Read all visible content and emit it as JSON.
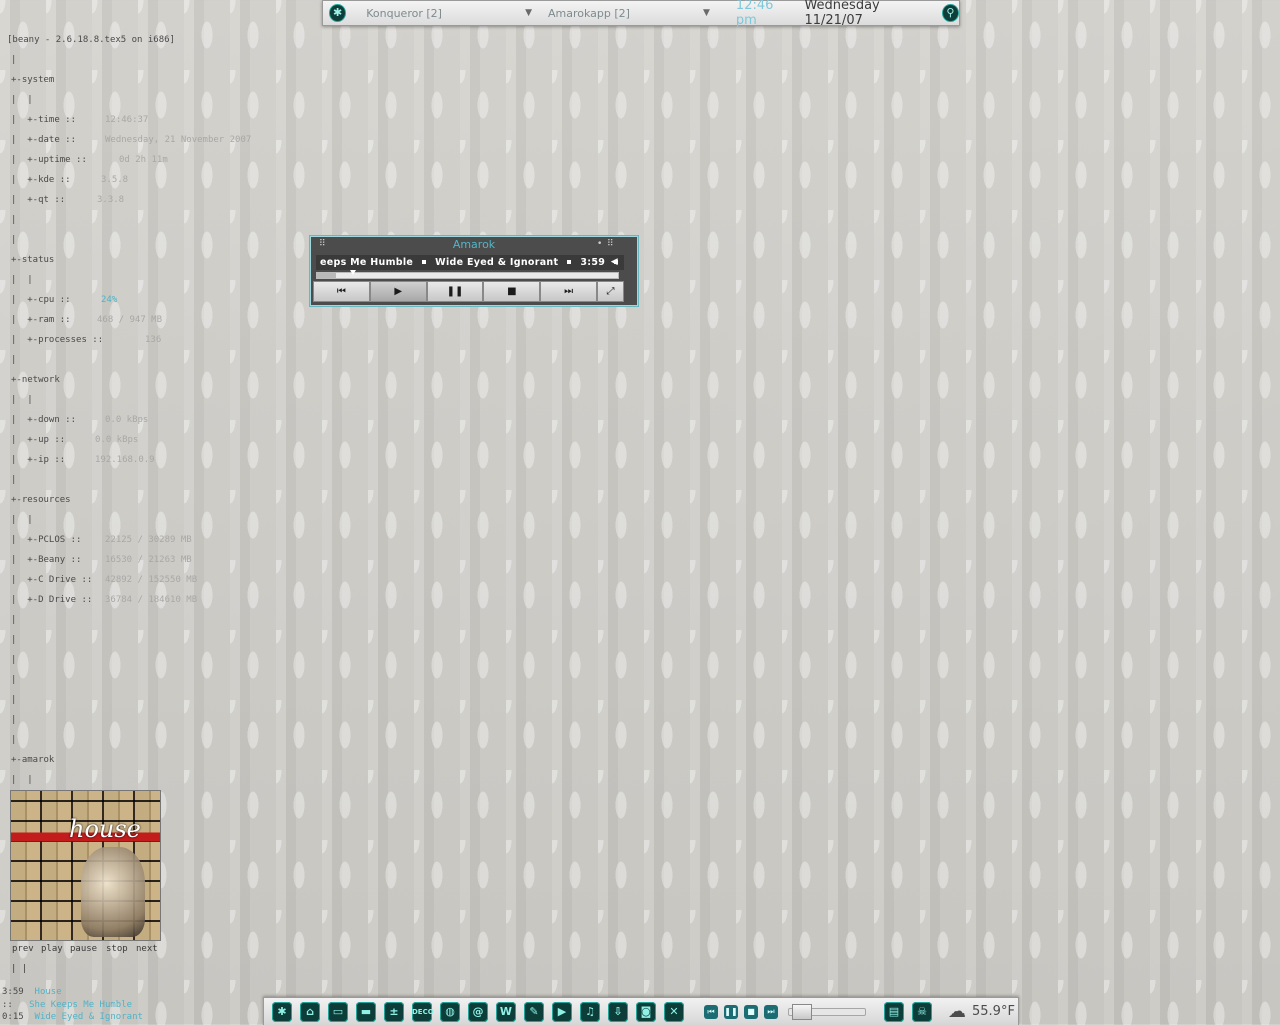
{
  "top_panel": {
    "tasks": [
      {
        "label": "Konqueror [2]",
        "icon": "collapse-arrow-icon"
      },
      {
        "label": "Amarokapp [2]",
        "icon": "collapse-arrow-icon"
      }
    ],
    "clock_time": "12:46 pm",
    "clock_date": "Wednesday  11/21/07"
  },
  "sysinfo": {
    "header": "[beany - 2.6.18.8.tex5 on i686]",
    "lines": [
      {
        "text": "|"
      },
      {
        "text": "+-system"
      },
      {
        "text": "|  |"
      },
      {
        "text": "|  +-time ::",
        "value": "12:46:37",
        "offset": 94
      },
      {
        "text": "|  +-date ::",
        "value": "Wednesday, 21 November 2007",
        "offset": 94
      },
      {
        "text": "|  +-uptime ::",
        "value": "0d 2h 11m",
        "offset": 108
      },
      {
        "text": "|  +-kde ::",
        "value": "3.5.8",
        "offset": 90
      },
      {
        "text": "|  +-qt ::",
        "value": "3.3.8",
        "offset": 86
      },
      {
        "text": "|"
      },
      {
        "text": "|"
      },
      {
        "text": "+-status"
      },
      {
        "text": "|  |"
      },
      {
        "text": "|  +-cpu ::",
        "value": "24%",
        "offset": 90,
        "highlight": true
      },
      {
        "text": "|  +-ram ::",
        "value": "468 / 947 MB",
        "offset": 86
      },
      {
        "text": "|  +-processes ::",
        "value": "136",
        "offset": 134
      },
      {
        "text": "|"
      },
      {
        "text": "+-network"
      },
      {
        "text": "|  |"
      },
      {
        "text": "|  +-down ::",
        "value": "0.0 kBps",
        "offset": 94
      },
      {
        "text": "|  +-up ::",
        "value": "0.0 kBps",
        "offset": 84
      },
      {
        "text": "|  +-ip ::",
        "value": "192.168.0.9",
        "offset": 84
      },
      {
        "text": "|"
      },
      {
        "text": "+-resources"
      },
      {
        "text": "|  |"
      },
      {
        "text": "|  +-PCLOS ::",
        "value": "22125 / 30289 MB",
        "offset": 94
      },
      {
        "text": "|  +-Beany ::",
        "value": "16530 / 21263 MB",
        "offset": 94
      },
      {
        "text": "|  +-C Drive ::",
        "value": "42892 / 152550 MB",
        "offset": 94
      },
      {
        "text": "|  +-D Drive ::",
        "value": "36784 / 184610 MB",
        "offset": 94
      },
      {
        "text": "|"
      },
      {
        "text": "|"
      },
      {
        "text": "|"
      },
      {
        "text": "|"
      },
      {
        "text": "|"
      },
      {
        "text": "|"
      },
      {
        "text": "|"
      },
      {
        "text": "+-amarok"
      },
      {
        "text": "|  |"
      }
    ]
  },
  "music_controls": [
    "prev",
    "play",
    "pause",
    "stop",
    "next"
  ],
  "music_tail": "|  |",
  "now_playing": {
    "length": "3:59",
    "album": "House",
    "sep": "::",
    "title": "She Keeps Me Humble",
    "elapsed": "0:15",
    "artist": "Wide Eyed & Ignorant"
  },
  "cover": {
    "word": "house"
  },
  "amarok": {
    "title": "Amarok",
    "scroll_parts": [
      "eeps Me Humble",
      "Wide Eyed & Ignorant",
      "3:59"
    ],
    "progress": 0.063,
    "buttons": [
      {
        "name": "previous",
        "glyph": "⏮"
      },
      {
        "name": "play",
        "glyph": "▶"
      },
      {
        "name": "pause",
        "glyph": "❚❚"
      },
      {
        "name": "stop",
        "glyph": "■"
      },
      {
        "name": "next",
        "glyph": "⏭"
      }
    ],
    "expand_glyph": "⤢"
  },
  "bottom_panel": {
    "launchers": [
      {
        "name": "kmenu",
        "glyph": "✱"
      },
      {
        "name": "home",
        "glyph": "⌂"
      },
      {
        "name": "file-manager",
        "glyph": "▭"
      },
      {
        "name": "terminal",
        "glyph": "▬"
      },
      {
        "name": "calculator",
        "glyph": "±"
      },
      {
        "name": "deco",
        "glyph": "DECO"
      },
      {
        "name": "browser",
        "glyph": "◍"
      },
      {
        "name": "email",
        "glyph": "@"
      },
      {
        "name": "office",
        "glyph": "W"
      },
      {
        "name": "text-editor",
        "glyph": "✎"
      },
      {
        "name": "video",
        "glyph": "▶"
      },
      {
        "name": "music",
        "glyph": "♫"
      },
      {
        "name": "downloader",
        "glyph": "⇩"
      },
      {
        "name": "camera",
        "glyph": "◙"
      },
      {
        "name": "settings",
        "glyph": "✕"
      }
    ],
    "media": [
      {
        "name": "prev",
        "glyph": "⏮"
      },
      {
        "name": "pause",
        "glyph": "❚❚"
      },
      {
        "name": "stop",
        "glyph": "■"
      },
      {
        "name": "next",
        "glyph": "⏭"
      }
    ],
    "slider_value": 0.05,
    "tray": [
      {
        "name": "clipboard",
        "glyph": "▤"
      },
      {
        "name": "skull",
        "glyph": "☠"
      }
    ],
    "weather_icon": "cloud-icon",
    "temperature": "55.9°F"
  }
}
